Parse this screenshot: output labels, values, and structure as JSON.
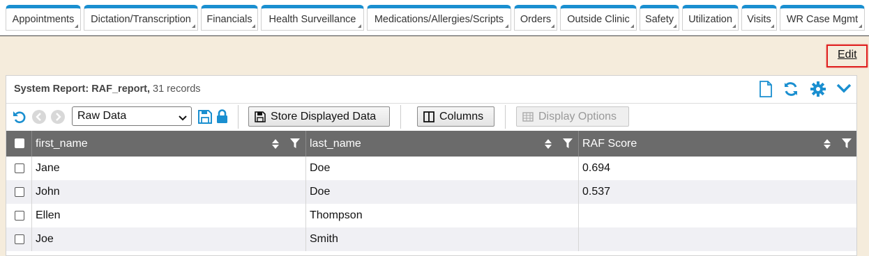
{
  "tabs": [
    "Appointments",
    "Dictation/Transcription",
    "Financials",
    "Health Surveillance",
    "Medications/Allergies/Scripts",
    "Orders",
    "Outside Clinic",
    "Safety",
    "Utilization",
    "Visits",
    "WR Case Mgmt"
  ],
  "edit_label": "Edit",
  "report": {
    "title": "System Report: RAF_report,",
    "count": "31 records"
  },
  "toolbar": {
    "view_select": "Raw Data",
    "store_button": "Store Displayed Data",
    "columns_button": "Columns",
    "display_options_button": "Display Options"
  },
  "table": {
    "columns": [
      "first_name",
      "last_name",
      "RAF Score"
    ],
    "rows": [
      [
        "Jane",
        "Doe",
        "0.694"
      ],
      [
        "John",
        "Doe",
        "0.537"
      ],
      [
        "Ellen",
        "Thompson",
        ""
      ],
      [
        "Joe",
        "Smith",
        ""
      ]
    ]
  },
  "colors": {
    "accent": "#1a8fd0",
    "header_bg": "#6b6b6b",
    "page_bg": "#f5ecdc",
    "highlight": "#e02020"
  }
}
